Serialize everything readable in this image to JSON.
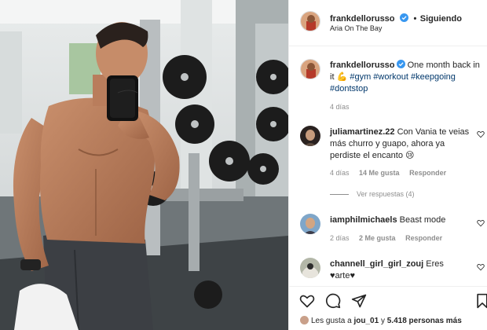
{
  "post": {
    "image_alt": "Gym selfie"
  },
  "header": {
    "username": "frankdellorusso",
    "separator": "•",
    "follow_label": "Siguiendo",
    "location": "Aria On The Bay"
  },
  "caption": {
    "username": "frankdellorusso",
    "text": "One month back in it",
    "emoji": "💪",
    "hashtags": [
      "#gym",
      "#workout",
      "#keepgoing",
      "#dontstop"
    ],
    "time": "4 días"
  },
  "comments": [
    {
      "username": "juliamartinez.22",
      "text": "Con Vania te veias más churro y guapo, ahora ya perdiste el encanto",
      "emoji": "😢",
      "time": "4 días",
      "likes": "14 Me gusta",
      "reply_label": "Responder",
      "view_replies": "Ver respuestas (4)"
    },
    {
      "username": "iamphilmichaels",
      "text": "Beast mode",
      "time": "2 días",
      "likes": "2 Me gusta",
      "reply_label": "Responder"
    },
    {
      "username": "channell_girl_girl_zouj",
      "text": "Eres ♥arte♥"
    }
  ],
  "likes_line": {
    "prefix": "Les gusta a",
    "user": "jou_01",
    "connector": "y",
    "count": "5.418 personas más"
  },
  "icons": [
    "verified-badge-icon",
    "like-icon",
    "comment-icon",
    "share-icon",
    "save-icon",
    "comment-heart-icon"
  ],
  "colors": {
    "verified": "#3897f0",
    "hashtag": "#00376b",
    "secondary_text": "#8e8e8e",
    "divider": "#efefef"
  }
}
